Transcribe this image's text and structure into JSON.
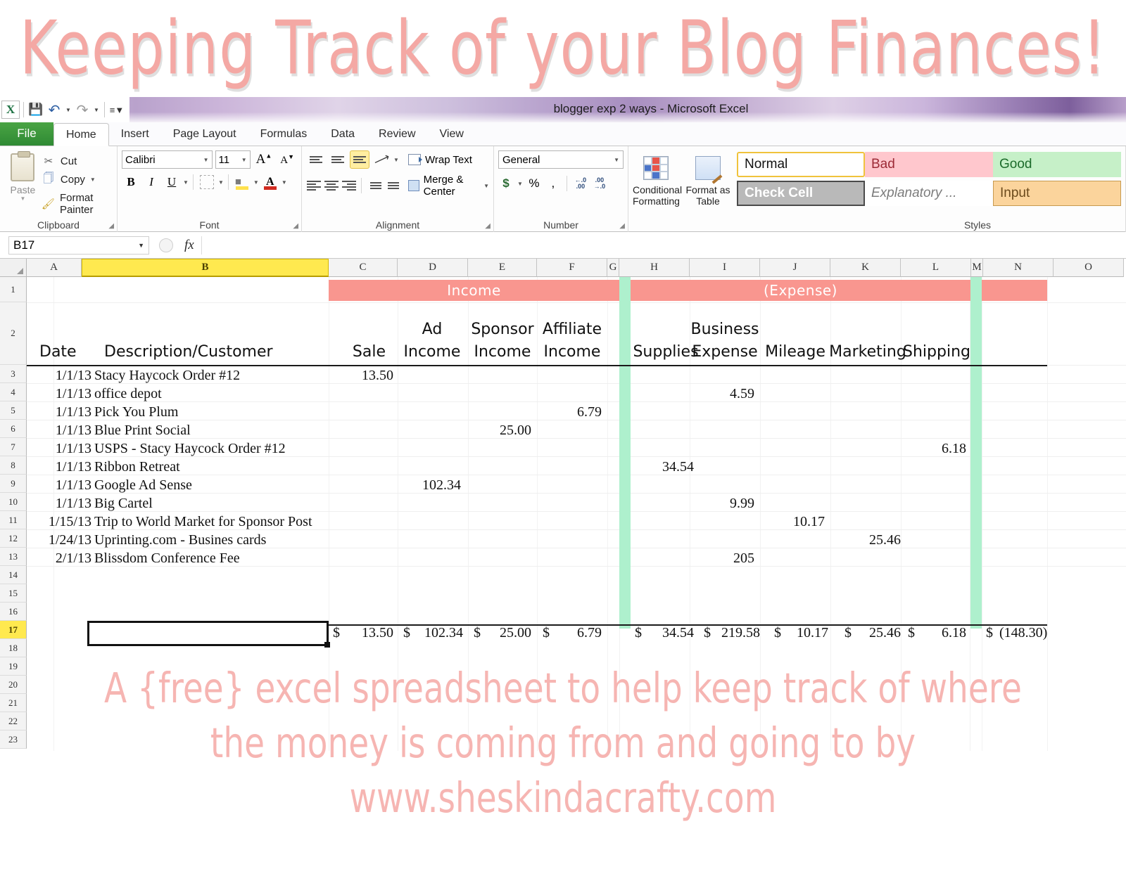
{
  "banner": {
    "title": "Keeping Track of your Blog Finances!"
  },
  "window": {
    "title": "blogger exp 2 ways  -  Microsoft Excel",
    "quick_access": {
      "app_icon": "excel-x-icon",
      "save": "save-icon",
      "undo": "undo-icon",
      "redo": "redo-icon",
      "customize": "customize-icon"
    }
  },
  "ribbon": {
    "tabs": [
      {
        "label": "File",
        "active": false
      },
      {
        "label": "Home",
        "active": true
      },
      {
        "label": "Insert",
        "active": false
      },
      {
        "label": "Page Layout",
        "active": false
      },
      {
        "label": "Formulas",
        "active": false
      },
      {
        "label": "Data",
        "active": false
      },
      {
        "label": "Review",
        "active": false
      },
      {
        "label": "View",
        "active": false
      }
    ],
    "clipboard": {
      "group_label": "Clipboard",
      "paste": "Paste",
      "cut": "Cut",
      "copy": "Copy",
      "format_painter": "Format Painter"
    },
    "font": {
      "group_label": "Font",
      "family": "Calibri",
      "size": "11",
      "grow": "A",
      "shrink": "A",
      "bold": "B",
      "italic": "I",
      "underline": "U"
    },
    "alignment": {
      "group_label": "Alignment",
      "wrap_text": "Wrap Text",
      "merge_center": "Merge & Center"
    },
    "number": {
      "group_label": "Number",
      "format": "General",
      "currency": "$",
      "percent": "%",
      "comma": ",",
      "increase_decimal": ".00",
      "decrease_decimal": ".00"
    },
    "styles": {
      "group_label": "Styles",
      "conditional_formatting": "Conditional Formatting",
      "format_as_table": "Format as Table",
      "cells": [
        {
          "label": "Normal",
          "kind": "normal"
        },
        {
          "label": "Bad",
          "kind": "bad"
        },
        {
          "label": "Good",
          "kind": "good"
        },
        {
          "label": "Check Cell",
          "kind": "check"
        },
        {
          "label": "Explanatory ...",
          "kind": "explanatory"
        },
        {
          "label": "Input",
          "kind": "input"
        }
      ]
    }
  },
  "formula_bar": {
    "name_box": "B17",
    "fx_label": "fx",
    "formula_value": ""
  },
  "grid": {
    "column_headers": [
      "A",
      "B",
      "C",
      "D",
      "E",
      "F",
      "G",
      "H",
      "I",
      "J",
      "K",
      "L",
      "M",
      "N",
      "O"
    ],
    "selected_column": "B",
    "selected_row": "17",
    "row_headers": [
      "1",
      "2",
      "3",
      "4",
      "5",
      "6",
      "7",
      "8",
      "9",
      "10",
      "11",
      "12",
      "13",
      "14",
      "15",
      "16",
      "17",
      "18",
      "19",
      "20",
      "21",
      "22",
      "23"
    ],
    "banners": [
      {
        "label": "Income",
        "color": "#f9968f"
      },
      {
        "label": "(Expense)",
        "color": "#f9968f"
      }
    ],
    "headers": {
      "date": "Date",
      "description": "Description/Customer",
      "sale": "Sale",
      "ad_income_1": "Ad",
      "ad_income_2": "Income",
      "sponsor_income_1": "Sponsor",
      "sponsor_income_2": "Income",
      "affiliate_income_1": "Affiliate",
      "affiliate_income_2": "Income",
      "supplies": "Supplies",
      "business_1": "Business",
      "business_2": "Expense",
      "mileage": "Mileage",
      "marketing": "Marketing",
      "shipping": "Shipping"
    },
    "rows": [
      {
        "row": "3",
        "date": "1/1/13",
        "desc": "Stacy Haycock Order #12",
        "sale": "13.50",
        "ad": "",
        "sponsor": "",
        "affiliate": "",
        "supplies": "",
        "business": "",
        "mileage": "",
        "marketing": "",
        "shipping": ""
      },
      {
        "row": "4",
        "date": "1/1/13",
        "desc": "office depot",
        "sale": "",
        "ad": "",
        "sponsor": "",
        "affiliate": "",
        "supplies": "",
        "business": "4.59",
        "mileage": "",
        "marketing": "",
        "shipping": ""
      },
      {
        "row": "5",
        "date": "1/1/13",
        "desc": "Pick You Plum",
        "sale": "",
        "ad": "",
        "sponsor": "",
        "affiliate": "6.79",
        "supplies": "",
        "business": "",
        "mileage": "",
        "marketing": "",
        "shipping": ""
      },
      {
        "row": "6",
        "date": "1/1/13",
        "desc": "Blue Print Social",
        "sale": "",
        "ad": "",
        "sponsor": "25.00",
        "affiliate": "",
        "supplies": "",
        "business": "",
        "mileage": "",
        "marketing": "",
        "shipping": ""
      },
      {
        "row": "7",
        "date": "1/1/13",
        "desc": "USPS - Stacy Haycock Order #12",
        "sale": "",
        "ad": "",
        "sponsor": "",
        "affiliate": "",
        "supplies": "",
        "business": "",
        "mileage": "",
        "marketing": "",
        "shipping": "6.18"
      },
      {
        "row": "8",
        "date": "1/1/13",
        "desc": "Ribbon Retreat",
        "sale": "",
        "ad": "",
        "sponsor": "",
        "affiliate": "",
        "supplies": "34.54",
        "business": "",
        "mileage": "",
        "marketing": "",
        "shipping": ""
      },
      {
        "row": "9",
        "date": "1/1/13",
        "desc": "Google Ad Sense",
        "sale": "",
        "ad": "102.34",
        "sponsor": "",
        "affiliate": "",
        "supplies": "",
        "business": "",
        "mileage": "",
        "marketing": "",
        "shipping": ""
      },
      {
        "row": "10",
        "date": "1/1/13",
        "desc": "Big Cartel",
        "sale": "",
        "ad": "",
        "sponsor": "",
        "affiliate": "",
        "supplies": "",
        "business": "9.99",
        "mileage": "",
        "marketing": "",
        "shipping": ""
      },
      {
        "row": "11",
        "date": "1/15/13",
        "desc": "Trip to World Market for Sponsor Post",
        "sale": "",
        "ad": "",
        "sponsor": "",
        "affiliate": "",
        "supplies": "",
        "business": "",
        "mileage": "10.17",
        "marketing": "",
        "shipping": ""
      },
      {
        "row": "12",
        "date": "1/24/13",
        "desc": "Uprinting.com - Busines cards",
        "sale": "",
        "ad": "",
        "sponsor": "",
        "affiliate": "",
        "supplies": "",
        "business": "",
        "mileage": "",
        "marketing": "25.46",
        "shipping": ""
      },
      {
        "row": "13",
        "date": "2/1/13",
        "desc": "Blissdom Conference Fee",
        "sale": "",
        "ad": "",
        "sponsor": "",
        "affiliate": "",
        "supplies": "",
        "business": "205",
        "mileage": "",
        "marketing": "",
        "shipping": ""
      }
    ],
    "totals": {
      "row": "17",
      "currency_symbol": "$",
      "sale": "13.50",
      "ad": "102.34",
      "sponsor": "25.00",
      "affiliate": "6.79",
      "supplies": "34.54",
      "business": "219.58",
      "mileage": "10.17",
      "marketing": "25.46",
      "shipping": "6.18",
      "net": "(148.30)"
    }
  },
  "caption": {
    "line1": "A {free} excel spreadsheet to help keep track of where",
    "line2": "the money is coming from and going to by",
    "line3": "www.sheskindacrafty.com"
  },
  "chart_data": {
    "type": "table",
    "title": "Blog income and expense ledger",
    "columns": [
      "Date",
      "Description/Customer",
      "Sale",
      "Ad Income",
      "Sponsor Income",
      "Affiliate Income",
      "Supplies",
      "Business Expense",
      "Mileage",
      "Marketing",
      "Shipping"
    ],
    "rows": [
      [
        "1/1/13",
        "Stacy Haycock Order #12",
        13.5,
        null,
        null,
        null,
        null,
        null,
        null,
        null,
        null
      ],
      [
        "1/1/13",
        "office depot",
        null,
        null,
        null,
        null,
        null,
        4.59,
        null,
        null,
        null
      ],
      [
        "1/1/13",
        "Pick You Plum",
        null,
        null,
        null,
        6.79,
        null,
        null,
        null,
        null,
        null
      ],
      [
        "1/1/13",
        "Blue Print Social",
        null,
        null,
        25.0,
        null,
        null,
        null,
        null,
        null,
        null
      ],
      [
        "1/1/13",
        "USPS - Stacy Haycock Order #12",
        null,
        null,
        null,
        null,
        null,
        null,
        null,
        null,
        6.18
      ],
      [
        "1/1/13",
        "Ribbon Retreat",
        null,
        null,
        null,
        null,
        34.54,
        null,
        null,
        null,
        null
      ],
      [
        "1/1/13",
        "Google Ad Sense",
        null,
        102.34,
        null,
        null,
        null,
        null,
        null,
        null,
        null
      ],
      [
        "1/1/13",
        "Big Cartel",
        null,
        null,
        null,
        null,
        null,
        9.99,
        null,
        null,
        null
      ],
      [
        "1/15/13",
        "Trip to World Market for Sponsor Post",
        null,
        null,
        null,
        null,
        null,
        null,
        10.17,
        null,
        null
      ],
      [
        "1/24/13",
        "Uprinting.com - Busines cards",
        null,
        null,
        null,
        null,
        null,
        null,
        null,
        25.46,
        null
      ],
      [
        "2/1/13",
        "Blissdom Conference Fee",
        null,
        null,
        null,
        null,
        null,
        205,
        null,
        null,
        null
      ]
    ],
    "totals": [
      13.5,
      102.34,
      25.0,
      6.79,
      34.54,
      219.58,
      10.17,
      25.46,
      6.18
    ],
    "net_total": -148.3
  }
}
